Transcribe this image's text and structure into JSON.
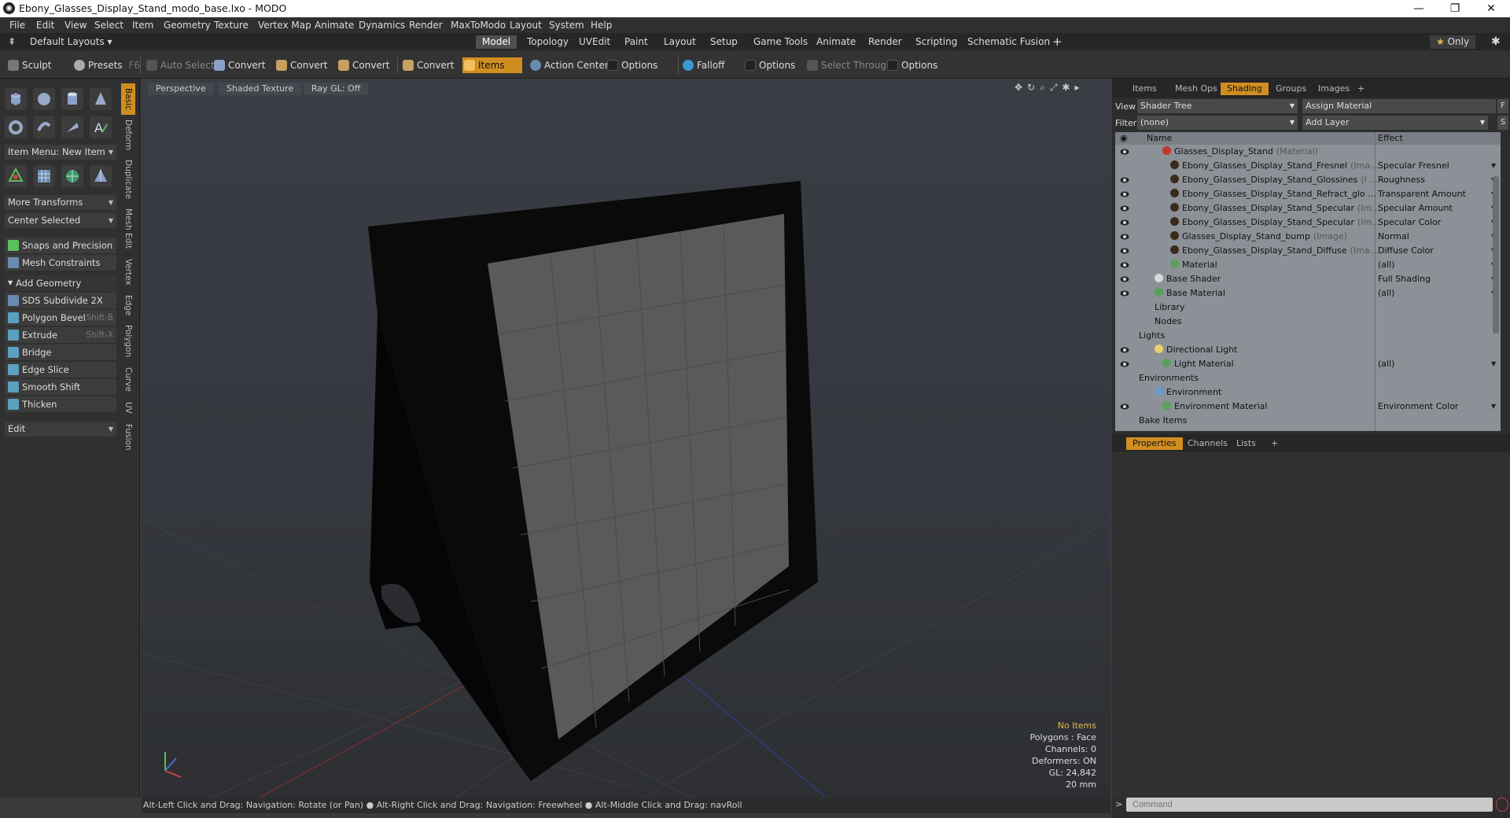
{
  "window": {
    "title": "Ebony_Glasses_Display_Stand_modo_base.lxo - MODO",
    "minimize": "—",
    "restore": "❐",
    "close": "✕"
  },
  "menu": [
    "File",
    "Edit",
    "View",
    "Select",
    "Item",
    "Geometry",
    "Texture",
    "Vertex Map",
    "Animate",
    "Dynamics",
    "Render",
    "MaxToModo",
    "Layout",
    "System",
    "Help"
  ],
  "layouts": {
    "default_label": "Default Layouts",
    "tabs": [
      "Model",
      "Topology",
      "UVEdit",
      "Paint",
      "Layout",
      "Setup",
      "Game Tools",
      "Animate",
      "Render",
      "Scripting",
      "Schematic Fusion"
    ],
    "active_tab": "Model",
    "add": "+",
    "only_label": "Only"
  },
  "toolbar": {
    "sculpt": "Sculpt",
    "presets": "Presets",
    "presets_key": "F6",
    "auto_select": "Auto Select",
    "convert1": "Convert",
    "convert2": "Convert",
    "convert3": "Convert",
    "convert4": "Convert",
    "items": "Items",
    "action_center": "Action Center",
    "options1": "Options",
    "falloff": "Falloff",
    "options2": "Options",
    "select_through": "Select Through",
    "options3": "Options"
  },
  "left": {
    "item_menu": "Item Menu: New Item",
    "more_transforms": "More Transforms",
    "center_selected": "Center Selected",
    "snaps": "Snaps and Precision",
    "mesh_constraints": "Mesh Constraints",
    "add_geometry": "Add Geometry",
    "tools": [
      {
        "label": "SDS Subdivide 2X",
        "shortcut": ""
      },
      {
        "label": "Polygon Bevel",
        "shortcut": "Shift-B"
      },
      {
        "label": "Extrude",
        "shortcut": "Shift-X"
      },
      {
        "label": "Bridge",
        "shortcut": ""
      },
      {
        "label": "Edge Slice",
        "shortcut": ""
      },
      {
        "label": "Smooth Shift",
        "shortcut": ""
      },
      {
        "label": "Thicken",
        "shortcut": ""
      }
    ],
    "edit_dropdown": "Edit",
    "vtabs": [
      "Basic",
      "Deform",
      "Duplicate",
      "Mesh Edit",
      "Vertex",
      "Edge",
      "Polygon",
      "Curve",
      "UV",
      "Fusion"
    ]
  },
  "viewport": {
    "view_mode": "Perspective",
    "shading": "Shaded Texture",
    "raygl": "Ray GL: Off",
    "info": {
      "items": "No Items",
      "polygons": "Polygons : Face",
      "channels": "Channels: 0",
      "deformers": "Deformers: ON",
      "gl": "GL: 24,842",
      "scale": "20 mm"
    }
  },
  "status": "Alt-Left Click and Drag: Navigation: Rotate (or Pan) ● Alt-Right Click and Drag: Navigation: Freewheel ● Alt-Middle Click and Drag: navRoll",
  "right": {
    "tabs": [
      "Items",
      "Mesh Ops",
      "Shading",
      "Groups",
      "Images"
    ],
    "active_tab": "Shading",
    "add": "+",
    "view_label": "View",
    "view_value": "Shader Tree",
    "assign_material": "Assign Material",
    "assign_key": "F",
    "filter_label": "Filter",
    "filter_value": "(none)",
    "add_layer": "Add Layer",
    "add_layer_key": "S",
    "col_name": "Name",
    "col_effect": "Effect",
    "rows": [
      {
        "name": "Glasses_Display_Stand",
        "type": "(Material)",
        "effect": "",
        "ball": "#c03a2b",
        "indent": 60,
        "eye": true,
        "arrow": false
      },
      {
        "name": "Ebony_Glasses_Display_Stand_Fresnel",
        "type": "(Ima...",
        "effect": "Specular Fresnel",
        "ball": "#3a2a1a",
        "indent": 70,
        "eye": false,
        "arrow": true
      },
      {
        "name": "Ebony_Glasses_Display_Stand_Glossines",
        "type": "(I ...",
        "effect": "Roughness",
        "ball": "#3a2a1a",
        "indent": 70,
        "eye": true,
        "arrow": true
      },
      {
        "name": "Ebony_Glasses_Display_Stand_Refract_glo ...",
        "type": "",
        "effect": "Transparent Amount",
        "ball": "#3a2a1a",
        "indent": 70,
        "eye": true,
        "arrow": true
      },
      {
        "name": "Ebony_Glasses_Display_Stand_Specular",
        "type": "(Im...",
        "effect": "Specular Amount",
        "ball": "#3a2a1a",
        "indent": 70,
        "eye": true,
        "arrow": true
      },
      {
        "name": "Ebony_Glasses_Display_Stand_Specular",
        "type": "(Im...",
        "effect": "Specular Color",
        "ball": "#3a2a1a",
        "indent": 70,
        "eye": true,
        "arrow": true
      },
      {
        "name": "Glasses_Display_Stand_bump",
        "type": "(Image)",
        "effect": "Normal",
        "ball": "#3a2a1a",
        "indent": 70,
        "eye": true,
        "arrow": true
      },
      {
        "name": "Ebony_Glasses_Display_Stand_Diffuse",
        "type": "(Ima...",
        "effect": "Diffuse Color",
        "ball": "#3a2a1a",
        "indent": 70,
        "eye": true,
        "arrow": true
      },
      {
        "name": "Material",
        "type": "",
        "effect": "(all)",
        "ball": "#5aa05a",
        "indent": 70,
        "eye": true,
        "arrow": true
      },
      {
        "name": "Base Shader",
        "type": "",
        "effect": "Full Shading",
        "ball": "#d8d8d8",
        "indent": 50,
        "eye": true,
        "arrow": true
      },
      {
        "name": "Base Material",
        "type": "",
        "effect": "(all)",
        "ball": "#5aa05a",
        "indent": 50,
        "eye": true,
        "arrow": true
      },
      {
        "name": "Library",
        "type": "",
        "effect": "",
        "ball": "",
        "indent": 50,
        "eye": false,
        "arrow": false
      },
      {
        "name": "Nodes",
        "type": "",
        "effect": "",
        "ball": "",
        "indent": 50,
        "eye": false,
        "arrow": false
      },
      {
        "name": "Lights",
        "type": "",
        "effect": "",
        "ball": "",
        "indent": 30,
        "eye": false,
        "arrow": false
      },
      {
        "name": "Directional Light",
        "type": "",
        "effect": "",
        "ball": "#e8d070",
        "indent": 50,
        "eye": true,
        "arrow": false
      },
      {
        "name": "Light Material",
        "type": "",
        "effect": "(all)",
        "ball": "#5aa05a",
        "indent": 60,
        "eye": true,
        "arrow": true
      },
      {
        "name": "Environments",
        "type": "",
        "effect": "",
        "ball": "",
        "indent": 30,
        "eye": false,
        "arrow": false
      },
      {
        "name": "Environment",
        "type": "",
        "effect": "",
        "ball": "#6a9ad0",
        "indent": 50,
        "eye": false,
        "arrow": false
      },
      {
        "name": "Environment Material",
        "type": "",
        "effect": "Environment Color",
        "ball": "#5aa05a",
        "indent": 60,
        "eye": true,
        "arrow": true
      },
      {
        "name": "Bake Items",
        "type": "",
        "effect": "",
        "ball": "",
        "indent": 30,
        "eye": false,
        "arrow": false
      }
    ],
    "props_tabs": [
      "Properties",
      "Channels",
      "Lists"
    ],
    "props_active": "Properties",
    "command_placeholder": "Command"
  },
  "colors": {
    "accent": "#d08e20",
    "tree_bg": "#8c9097",
    "info_highlight": "#e8b84a"
  }
}
